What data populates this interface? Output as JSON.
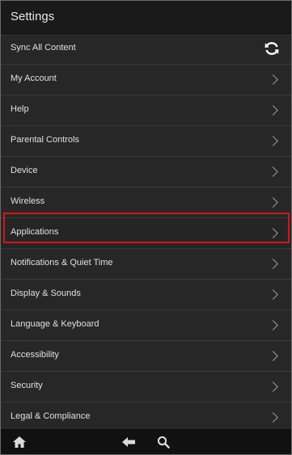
{
  "header": {
    "title": "Settings"
  },
  "items": [
    {
      "label": "Sync All Content",
      "icon": "sync-icon"
    },
    {
      "label": "My Account",
      "icon": "chevron-right-icon"
    },
    {
      "label": "Help",
      "icon": "chevron-right-icon"
    },
    {
      "label": "Parental Controls",
      "icon": "chevron-right-icon"
    },
    {
      "label": "Device",
      "icon": "chevron-right-icon"
    },
    {
      "label": "Wireless",
      "icon": "chevron-right-icon"
    },
    {
      "label": "Applications",
      "icon": "chevron-right-icon",
      "highlighted": true
    },
    {
      "label": "Notifications & Quiet Time",
      "icon": "chevron-right-icon"
    },
    {
      "label": "Display & Sounds",
      "icon": "chevron-right-icon"
    },
    {
      "label": "Language & Keyboard",
      "icon": "chevron-right-icon"
    },
    {
      "label": "Accessibility",
      "icon": "chevron-right-icon"
    },
    {
      "label": "Security",
      "icon": "chevron-right-icon"
    },
    {
      "label": "Legal & Compliance",
      "icon": "chevron-right-icon"
    }
  ],
  "bottom_bar": {
    "icons": [
      "home-icon",
      "back-arrow-icon",
      "search-icon"
    ]
  },
  "colors": {
    "background": "#232323",
    "header": "#1a1a1a",
    "text": "#e0e0e0",
    "highlight": "#d4151b"
  }
}
